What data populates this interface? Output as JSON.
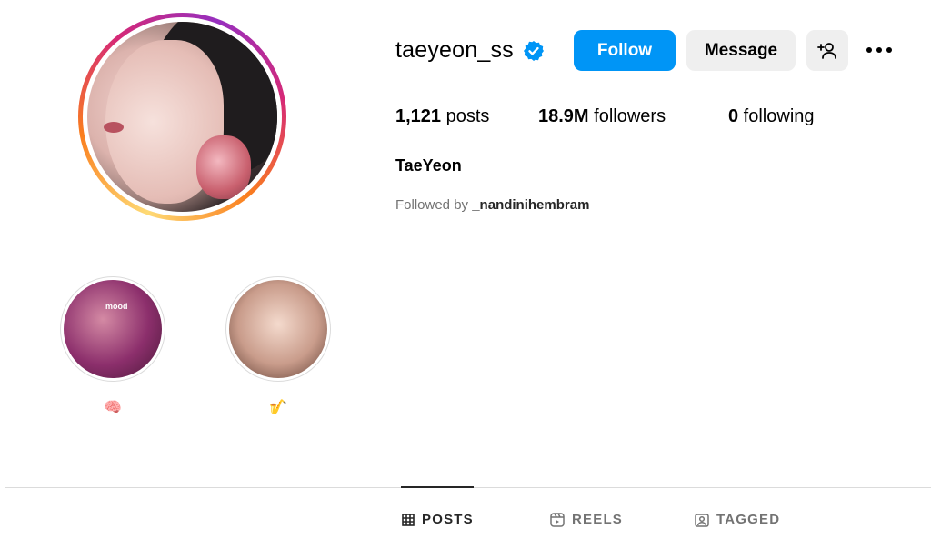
{
  "profile": {
    "username": "taeyeon_ss",
    "full_name": "TaeYeon",
    "followed_by_prefix": "Followed by ",
    "followed_by_user": "_nandinihembram"
  },
  "stats": {
    "posts_count": "1,121",
    "posts_label": " posts",
    "followers_count": "18.9M",
    "followers_label": " followers",
    "following_count": "0",
    "following_label": " following"
  },
  "actions": {
    "follow_label": "Follow",
    "message_label": "Message"
  },
  "highlights": [
    {
      "label": "🧠",
      "cover_text": "mood"
    },
    {
      "label": "🎷"
    }
  ],
  "tabs": [
    {
      "label": "POSTS",
      "icon": "grid-icon",
      "active": true
    },
    {
      "label": "REELS",
      "icon": "reels-icon",
      "active": false
    },
    {
      "label": "TAGGED",
      "icon": "tagged-icon",
      "active": false
    }
  ],
  "colors": {
    "primary_button": "#0095f6",
    "secondary_button": "#efefef",
    "verified_badge": "#0095f6",
    "text_primary": "#262626",
    "text_secondary": "#737373"
  }
}
